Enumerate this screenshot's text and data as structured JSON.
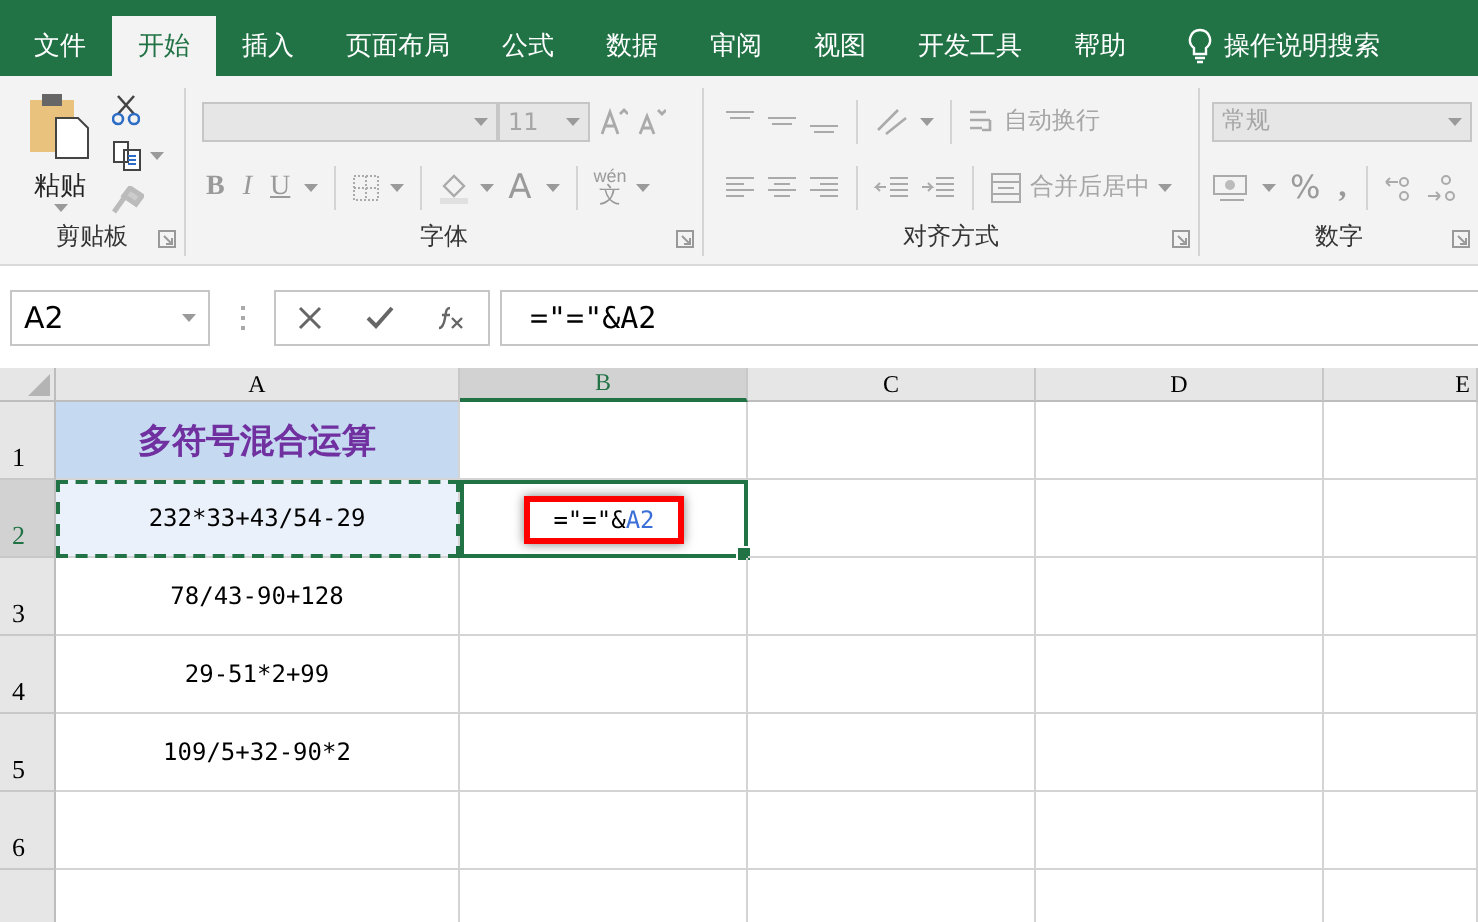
{
  "menu_tabs": [
    {
      "label": "文件",
      "selected": false
    },
    {
      "label": "开始",
      "selected": true
    },
    {
      "label": "插入",
      "selected": false
    },
    {
      "label": "页面布局",
      "selected": false
    },
    {
      "label": "公式",
      "selected": false
    },
    {
      "label": "数据",
      "selected": false
    },
    {
      "label": "审阅",
      "selected": false
    },
    {
      "label": "视图",
      "selected": false
    },
    {
      "label": "开发工具",
      "selected": false
    },
    {
      "label": "帮助",
      "selected": false
    }
  ],
  "tell_me": "操作说明搜索",
  "ribbon": {
    "clipboard": {
      "paste": "粘贴",
      "group": "剪贴板"
    },
    "font": {
      "size": "11",
      "bold": "B",
      "italic": "I",
      "underline": "U",
      "font_color": "A",
      "phonetic_top": "wén",
      "phonetic_bottom": "文",
      "group": "字体"
    },
    "alignment": {
      "wrap": "自动换行",
      "merge": "合并后居中",
      "group": "对齐方式"
    },
    "number": {
      "format": "常规",
      "percent": "%",
      "comma": ",",
      "group": "数字"
    }
  },
  "formula_bar": {
    "name_box": "A2",
    "formula": "=\"=\"&A2"
  },
  "columns": [
    {
      "label": "A",
      "selected": false
    },
    {
      "label": "B",
      "selected": true
    },
    {
      "label": "C",
      "selected": false
    },
    {
      "label": "D",
      "selected": false
    },
    {
      "label": "E",
      "selected": false
    }
  ],
  "rows": [
    {
      "header": "1",
      "selected": false,
      "a": {
        "text": "多符号混合运算",
        "kind": "title"
      }
    },
    {
      "header": "2",
      "selected": true,
      "a": {
        "text": "232*33+43/54-29",
        "kind": "copied"
      },
      "b": {
        "kind": "editing",
        "highlighted": true,
        "parts": [
          {
            "text": "=\"=\"&",
            "kind": "plain"
          },
          {
            "text": "A2",
            "kind": "reference"
          }
        ]
      }
    },
    {
      "header": "3",
      "selected": false,
      "a": {
        "text": "78/43-90+128",
        "kind": "plain"
      }
    },
    {
      "header": "4",
      "selected": false,
      "a": {
        "text": "29-51*2+99",
        "kind": "plain"
      }
    },
    {
      "header": "5",
      "selected": false,
      "a": {
        "text": "109/5+32-90*2",
        "kind": "plain"
      }
    },
    {
      "header": "6",
      "selected": false
    }
  ]
}
